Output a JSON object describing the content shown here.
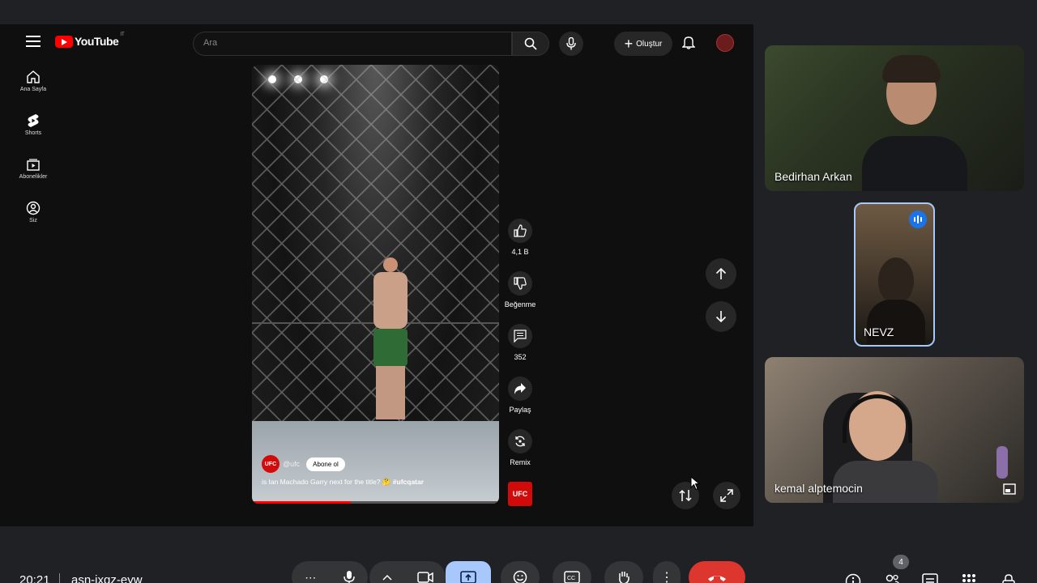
{
  "youtube": {
    "logo_text": "YouTube",
    "logo_country": "IT",
    "search_placeholder": "Ara",
    "create_label": "Oluştur",
    "sidebar": [
      {
        "label": "Ana Sayfa",
        "icon": "home-icon"
      },
      {
        "label": "Shorts",
        "icon": "shorts-icon"
      },
      {
        "label": "Abonelikler",
        "icon": "subscriptions-icon"
      },
      {
        "label": "Siz",
        "icon": "you-icon"
      }
    ],
    "short": {
      "channel_badge": "UFC",
      "channel_handle": "@ufc",
      "subscribe_label": "Abone ol",
      "caption_text": "is Ian Machado Garry next for the title? 🤔",
      "caption_tag": "#ufcqatar",
      "progress": 0.4
    },
    "actions": {
      "like_count": "4,1 B",
      "dislike_label": "Beğenme",
      "comment_count": "352",
      "share_label": "Paylaş",
      "remix_label": "Remix",
      "channel_thumb": "UFC"
    }
  },
  "participants": [
    {
      "name": "Bedirhan Arkan"
    },
    {
      "name": "NEVZ",
      "speaking": true
    },
    {
      "name": "kemal alptemocin"
    }
  ],
  "meeting": {
    "time": "20:21",
    "code": "asn-ixqz-eyw",
    "participant_count": "4"
  },
  "colors": {
    "accent": "#a8c7fa",
    "end_call": "#dc362e",
    "youtube_red": "#ff0000",
    "ufc_red": "#d20a0a"
  }
}
